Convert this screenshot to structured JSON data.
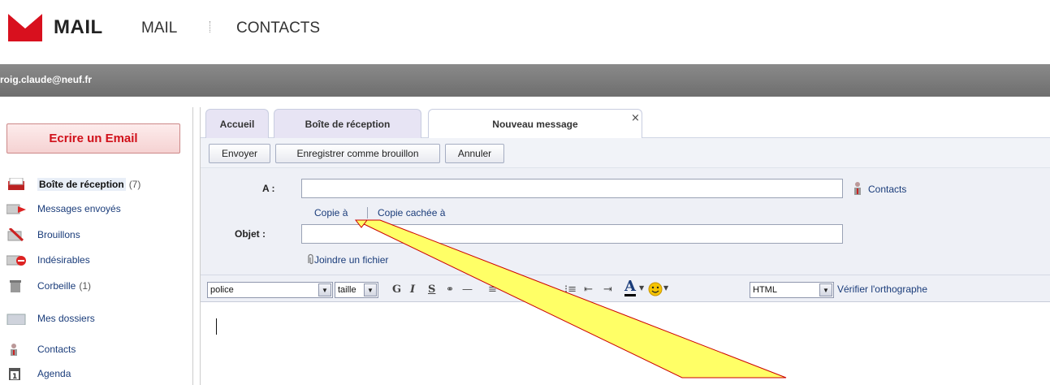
{
  "header": {
    "brand": "MAIL",
    "nav": [
      "MAIL",
      "CONTACTS"
    ],
    "user_email": "roig.claude@neuf.fr",
    "brand_color": "#d8101e"
  },
  "sidebar": {
    "compose_label": "Ecrire un Email",
    "folders": [
      {
        "label": "Boîte de réception",
        "count": "(7)",
        "icon": "inbox-icon",
        "active": true
      },
      {
        "label": "Messages envoyés",
        "count": "",
        "icon": "sent-icon"
      },
      {
        "label": "Brouillons",
        "count": "",
        "icon": "drafts-icon"
      },
      {
        "label": "Indésirables",
        "count": "",
        "icon": "spam-icon"
      },
      {
        "label": "Corbeille",
        "count": "(1)",
        "icon": "trash-icon"
      },
      {
        "label": "Mes dossiers",
        "count": "",
        "icon": "folder-icon"
      },
      {
        "label": "Contacts",
        "count": "",
        "icon": "contacts-icon"
      },
      {
        "label": "Agenda",
        "count": "",
        "icon": "calendar-icon"
      }
    ]
  },
  "tabs": [
    {
      "label": "Accueil"
    },
    {
      "label": "Boîte de réception"
    },
    {
      "label": "Nouveau message",
      "active": true
    }
  ],
  "tab_close": "×",
  "toolbar": {
    "send": "Envoyer",
    "save_draft": "Enregistrer comme brouillon",
    "cancel": "Annuler"
  },
  "form": {
    "to_label": "A :",
    "to_value": "",
    "contacts_link": "Contacts",
    "cc_link": "Copie à",
    "bcc_link": "Copie cachée à",
    "subject_label": "Objet :",
    "subject_value": "",
    "attach_link": "Joindre un fichier"
  },
  "editor": {
    "font_select": "police",
    "size_select": "taille",
    "format_select": "HTML",
    "spellcheck": "Vérifier l'orthographe",
    "bold": "G",
    "italic": "I",
    "underline": "S"
  }
}
